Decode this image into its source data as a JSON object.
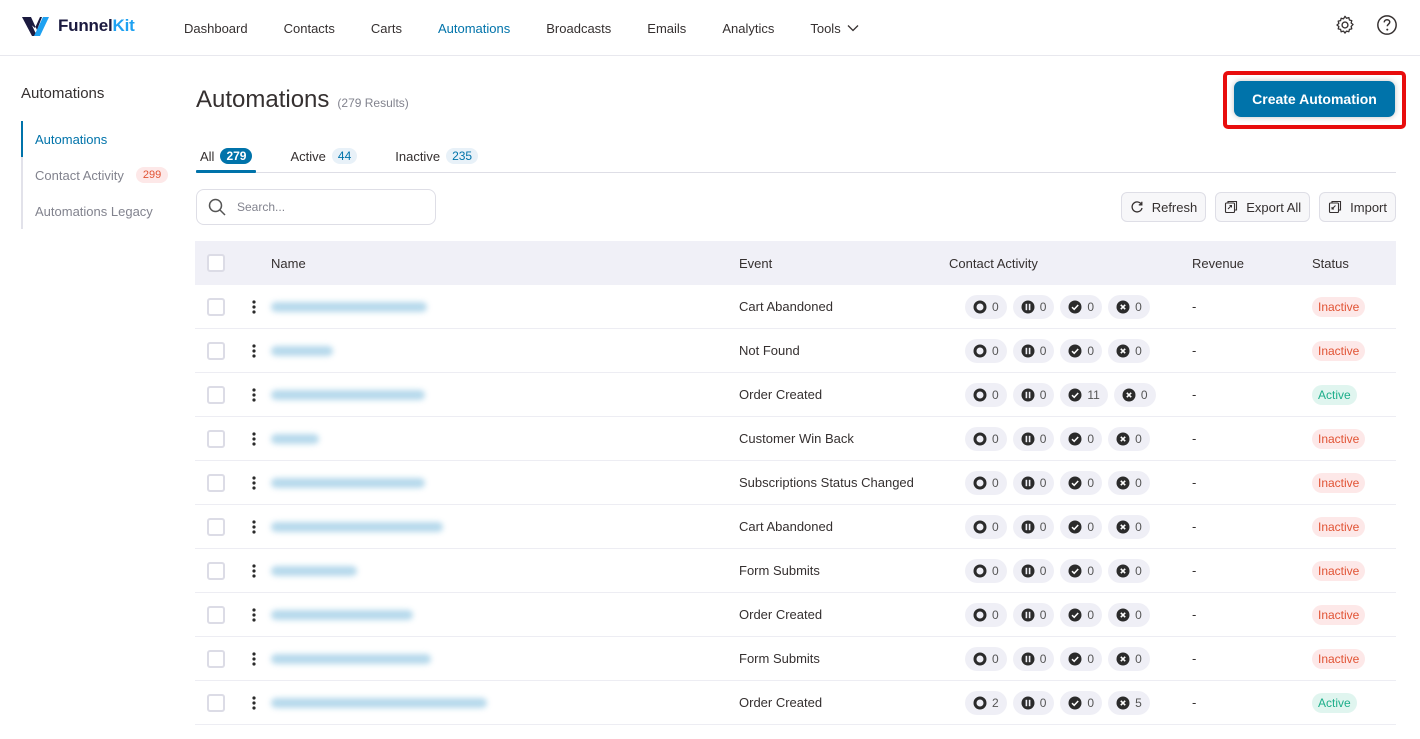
{
  "brand": {
    "name_part1": "Funnel",
    "name_part2": "Kit"
  },
  "nav": {
    "items": [
      {
        "label": "Dashboard",
        "active": false
      },
      {
        "label": "Contacts",
        "active": false
      },
      {
        "label": "Carts",
        "active": false
      },
      {
        "label": "Automations",
        "active": true
      },
      {
        "label": "Broadcasts",
        "active": false
      },
      {
        "label": "Emails",
        "active": false
      },
      {
        "label": "Analytics",
        "active": false
      },
      {
        "label": "Tools",
        "active": false,
        "has_dropdown": true
      }
    ],
    "icons": [
      "gear-icon",
      "help-icon"
    ]
  },
  "sidebar": {
    "title": "Automations",
    "items": [
      {
        "label": "Automations",
        "active": true
      },
      {
        "label": "Contact Activity",
        "badge": "299"
      },
      {
        "label": "Automations Legacy"
      }
    ]
  },
  "header": {
    "title": "Automations",
    "results": "(279 Results)",
    "create_label": "Create Automation"
  },
  "tabs": [
    {
      "label": "All",
      "count": "279",
      "active": true
    },
    {
      "label": "Active",
      "count": "44"
    },
    {
      "label": "Inactive",
      "count": "235"
    }
  ],
  "search": {
    "placeholder": "Search...",
    "value": ""
  },
  "actions": {
    "refresh": "Refresh",
    "export": "Export All",
    "import": "Import"
  },
  "table": {
    "columns": {
      "name": "Name",
      "event": "Event",
      "activity": "Contact Activity",
      "revenue": "Revenue",
      "status": "Status"
    },
    "rows": [
      {
        "name": "(blurred)",
        "event": "Cart Abandoned",
        "activity": [
          "0",
          "0",
          "0",
          "0"
        ],
        "revenue": "-",
        "status": "Inactive"
      },
      {
        "name": "(blurred)",
        "event": "Not Found",
        "activity": [
          "0",
          "0",
          "0",
          "0"
        ],
        "revenue": "-",
        "status": "Inactive"
      },
      {
        "name": "(blurred)",
        "event": "Order Created",
        "activity": [
          "0",
          "0",
          "11",
          "0"
        ],
        "revenue": "-",
        "status": "Active"
      },
      {
        "name": "(blurred)",
        "event": "Customer Win Back",
        "activity": [
          "0",
          "0",
          "0",
          "0"
        ],
        "revenue": "-",
        "status": "Inactive"
      },
      {
        "name": "(blurred)",
        "event": "Subscriptions Status Changed",
        "activity": [
          "0",
          "0",
          "0",
          "0"
        ],
        "revenue": "-",
        "status": "Inactive"
      },
      {
        "name": "(blurred)",
        "event": "Cart Abandoned",
        "activity": [
          "0",
          "0",
          "0",
          "0"
        ],
        "revenue": "-",
        "status": "Inactive"
      },
      {
        "name": "(blurred)",
        "event": "Form Submits",
        "activity": [
          "0",
          "0",
          "0",
          "0"
        ],
        "revenue": "-",
        "status": "Inactive"
      },
      {
        "name": "(blurred)",
        "event": "Order Created",
        "activity": [
          "0",
          "0",
          "0",
          "0"
        ],
        "revenue": "-",
        "status": "Inactive"
      },
      {
        "name": "(blurred)",
        "event": "Form Submits",
        "activity": [
          "0",
          "0",
          "0",
          "0"
        ],
        "revenue": "-",
        "status": "Inactive"
      },
      {
        "name": "(blurred)",
        "event": "Order Created",
        "activity": [
          "2",
          "0",
          "0",
          "5"
        ],
        "revenue": "-",
        "status": "Active"
      }
    ],
    "activity_icons": [
      "active-circle-icon",
      "paused-icon",
      "completed-check-icon",
      "failed-x-icon"
    ]
  },
  "colors": {
    "accent": "#0073aa",
    "inactive": "#e15334",
    "active": "#1dae8a",
    "highlight": "#e80d0d"
  }
}
